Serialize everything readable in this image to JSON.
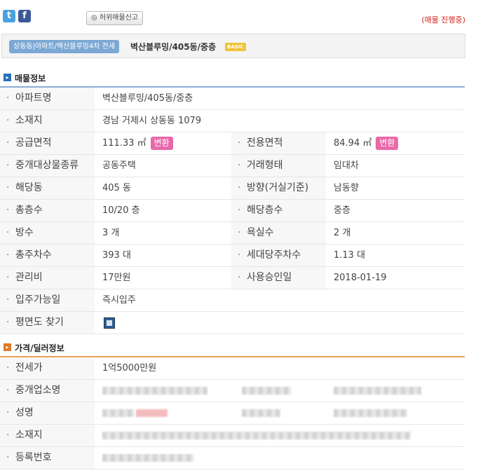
{
  "header": {
    "twitter": "t",
    "facebook": "f",
    "report_label": "◎ 허위매물신고",
    "status": "(매물 진행중)"
  },
  "title": {
    "crumb": "상동동|아파트/벽산블루밍4차 전세",
    "name": "벽산블루밍/405동/중층",
    "badge": "BASIC"
  },
  "section1": {
    "title": "매물정보",
    "rows": [
      {
        "l1": "아파트명",
        "v1": "벽산블루밍/405동/중층"
      },
      {
        "l1": "소재지",
        "v1": "경남 거제시 상동동 1079"
      },
      {
        "l1": "공급면적",
        "v1": "111.33 ㎡",
        "b1": "변환",
        "l2": "전용면적",
        "v2": "84.94 ㎡",
        "b2": "변환"
      },
      {
        "l1": "중개대상물종류",
        "v1": "공동주택",
        "l2": "거래형태",
        "v2": "임대차"
      },
      {
        "l1": "해당동",
        "v1": "405 동",
        "l2": "방향(거실기준)",
        "v2": "남동향"
      },
      {
        "l1": "총층수",
        "v1": "10/20 층",
        "l2": "해당층수",
        "v2": "중층"
      },
      {
        "l1": "방수",
        "v1": "3 개",
        "l2": "욕실수",
        "v2": "2 개"
      },
      {
        "l1": "총주차수",
        "v1": "393 대",
        "l2": "세대당주차수",
        "v2": "1.13 대"
      },
      {
        "l1": "관리비",
        "v1": "17만원",
        "l2": "사용승인일",
        "v2": "2018-01-19"
      },
      {
        "l1": "입주가능일",
        "v1": "즉시입주"
      },
      {
        "l1": "평면도 찾기"
      }
    ]
  },
  "section2": {
    "title": "가격/딜러정보",
    "rows": [
      {
        "l1": "전세가",
        "v1": "1억5000만원"
      },
      {
        "l1": "중개업소명"
      },
      {
        "l1": "성명"
      },
      {
        "l1": "소재지"
      },
      {
        "l1": "등록번호"
      }
    ]
  }
}
